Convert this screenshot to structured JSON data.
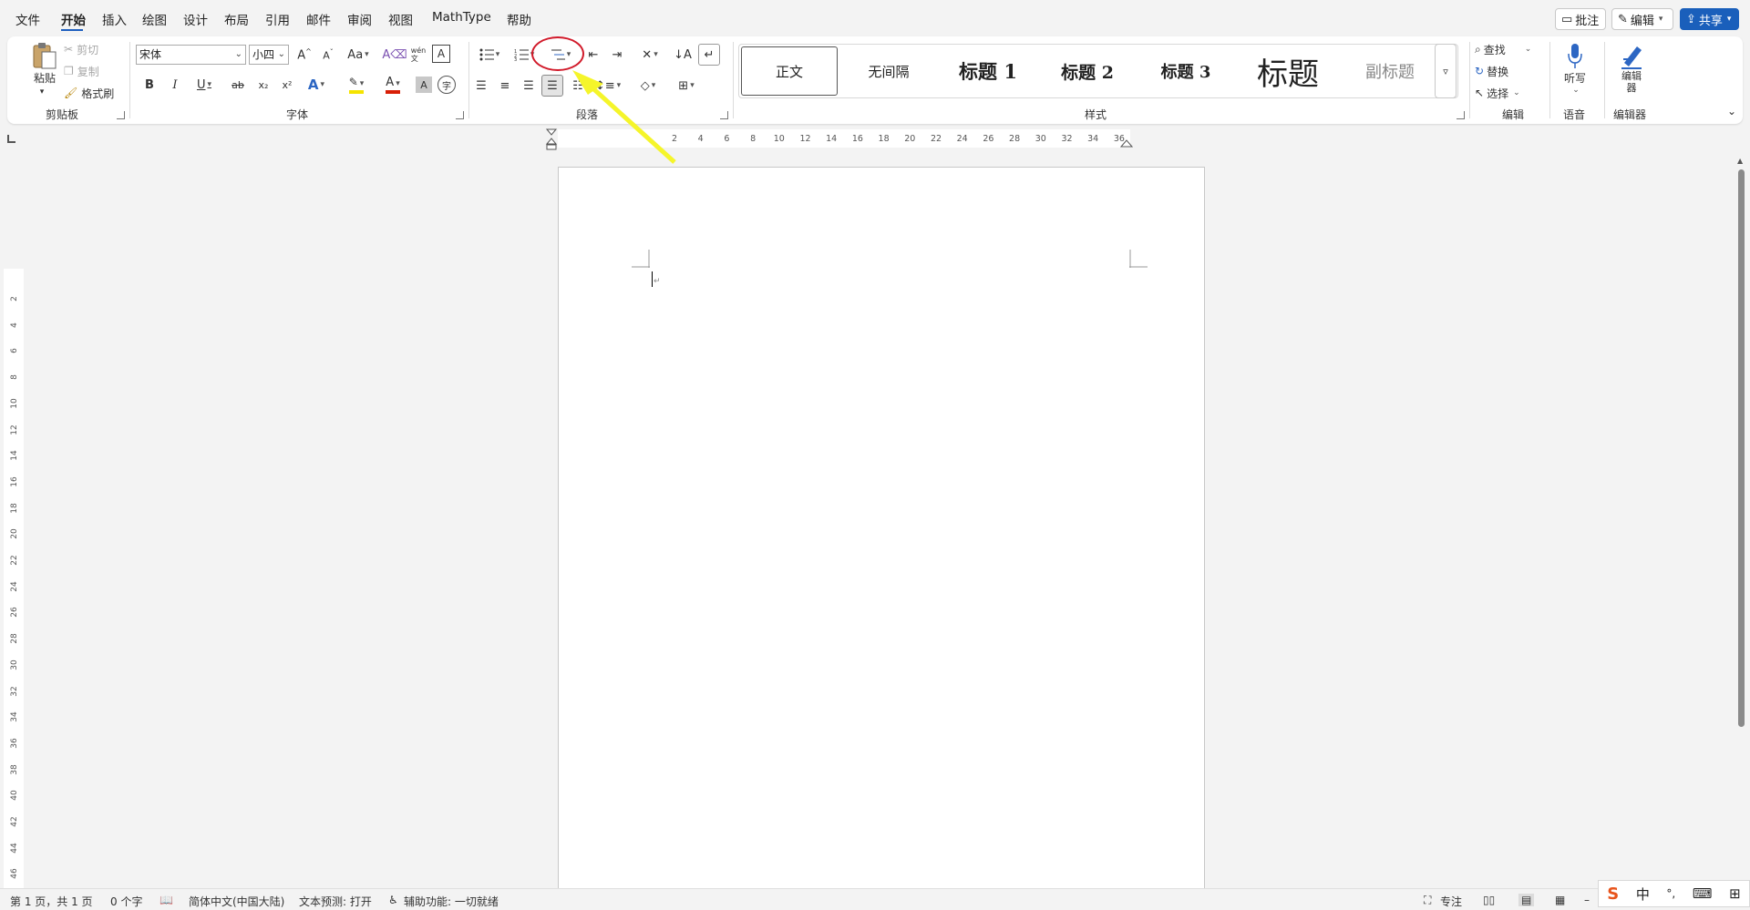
{
  "menu": {
    "items": [
      "文件",
      "开始",
      "插入",
      "绘图",
      "设计",
      "布局",
      "引用",
      "邮件",
      "审阅",
      "视图",
      "MathType",
      "帮助"
    ],
    "active_index": 1
  },
  "top_right": {
    "comment_label": "批注",
    "edit_label": "编辑",
    "share_label": "共享"
  },
  "clipboard": {
    "paste_label": "粘贴",
    "cut_label": "剪切",
    "copy_label": "复制",
    "format_painter_label": "格式刷",
    "group_label": "剪贴板"
  },
  "font": {
    "font_name": "宋体",
    "font_size": "小四",
    "group_label": "字体",
    "grow_label": "A^",
    "shrink_label": "A˅",
    "case_label": "Aa",
    "bold_label": "B",
    "italic_label": "I",
    "underline_label": "U",
    "strike_label": "ab",
    "subscript_label": "x₂",
    "superscript_label": "x²",
    "color_label": "A",
    "shade_label": "A",
    "phonetic_label": "wén",
    "highlight_color": "#f5e400",
    "font_color": "#d81e06"
  },
  "paragraph": {
    "group_label": "段落"
  },
  "styles": {
    "group_label": "样式",
    "items": [
      "正文",
      "无间隔",
      "标题 1",
      "标题 2",
      "标题 3",
      "标题",
      "副标题"
    ]
  },
  "editing": {
    "group_label": "编辑",
    "find_label": "查找",
    "replace_label": "替换",
    "select_label": "选择"
  },
  "voice": {
    "group_label": "语音",
    "dictate_label": "听写"
  },
  "editor": {
    "group_label": "编辑器",
    "editor_label": "编辑器"
  },
  "ruler": {
    "h_ticks": [
      "2",
      "4",
      "6",
      "8",
      "10",
      "12",
      "14",
      "16",
      "18",
      "20",
      "22",
      "24",
      "26",
      "28",
      "30",
      "32",
      "34",
      "36"
    ],
    "v_ticks": [
      "2",
      "4",
      "6",
      "8",
      "10",
      "12",
      "14",
      "16",
      "18",
      "20",
      "22",
      "24",
      "26",
      "28",
      "30",
      "32",
      "34",
      "36",
      "38",
      "40",
      "42",
      "44",
      "46"
    ]
  },
  "status": {
    "page": "第 1 页，共 1 页",
    "words": "0 个字",
    "language": "简体中文(中国大陆)",
    "prediction": "文本预测: 打开",
    "accessibility": "辅助功能: 一切就绪",
    "focus": "专注"
  },
  "ime": {
    "mode": "中",
    "punct": "°,"
  },
  "colors": {
    "accent": "#1a5fbb",
    "annotation_circle": "#d11a2a",
    "annotation_arrow": "#f5f52a"
  }
}
